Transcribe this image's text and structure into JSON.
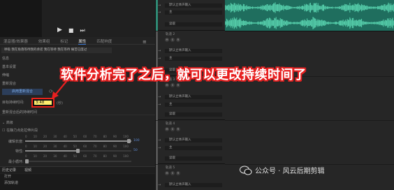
{
  "transport": {
    "play": "▶",
    "stop": "■",
    "to_end": "⏭"
  },
  "panel_tabs": [
    {
      "label": "混音器/效果器"
    },
    {
      "label": "效果组"
    },
    {
      "label": "标记"
    },
    {
      "label": "属性"
    },
    {
      "label": "匹配响度"
    }
  ],
  "properties": {
    "filename": "呼吸 我在角落等待我的承诺 我在等待 我在等待 痛苦已度过",
    "row_label_1": "信息",
    "row_label_2": "基本设置",
    "row_label_3": "伸缩",
    "row_label_4": "重新混合",
    "reverb_button": "启用重新混合",
    "duration_label": "目标持续时间:",
    "duration_value": "3:48",
    "duration_unit": "(秒)",
    "duration_hint": "重新混合后的持续时间",
    "advanced_label": "高级",
    "checkbox_label": "在静力点处拉伸片段",
    "slider_1_label": "编辑长度:",
    "slider_1_value": "100",
    "slider_2_label": "特性:",
    "slider_2_value": "50",
    "slider_3_label": "最小循环:",
    "ruler_ticks": [
      "0",
      "10",
      "20",
      "30",
      "40",
      "50",
      "60",
      "70",
      "80",
      "90",
      "100"
    ]
  },
  "history": {
    "tabs": [
      "历史记录",
      "视频"
    ],
    "items": [
      "打开",
      "添加轨道"
    ]
  },
  "tracks": [
    {
      "name": "",
      "input": "默认立体声输入",
      "output": "主",
      "mode": "读取"
    },
    {
      "name": "轨道 2",
      "input": "默认立体声输入",
      "output": "主",
      "mode": "读取"
    },
    {
      "name": "轨道 3",
      "input": "默认立体声输入",
      "output": "主",
      "mode": "读取"
    },
    {
      "name": "轨道 4",
      "input": "默认立体声输入",
      "output": "主",
      "mode": "读取"
    },
    {
      "name": "轨道 5",
      "input": "默认立体声输入",
      "output": "主",
      "mode": "读取"
    }
  ],
  "annotation": {
    "text": "软件分析完了之后，就可以更改持续时间了"
  },
  "watermark": {
    "text": "公众号 · 风云后期剪辑"
  },
  "colors": {
    "waveform": "#58d3ae",
    "waveform_bg": "#1f6e5e",
    "annotation_red": "#e82020",
    "highlight_yellow": "#ffee6e",
    "accent_blue": "#3f7bd8"
  }
}
